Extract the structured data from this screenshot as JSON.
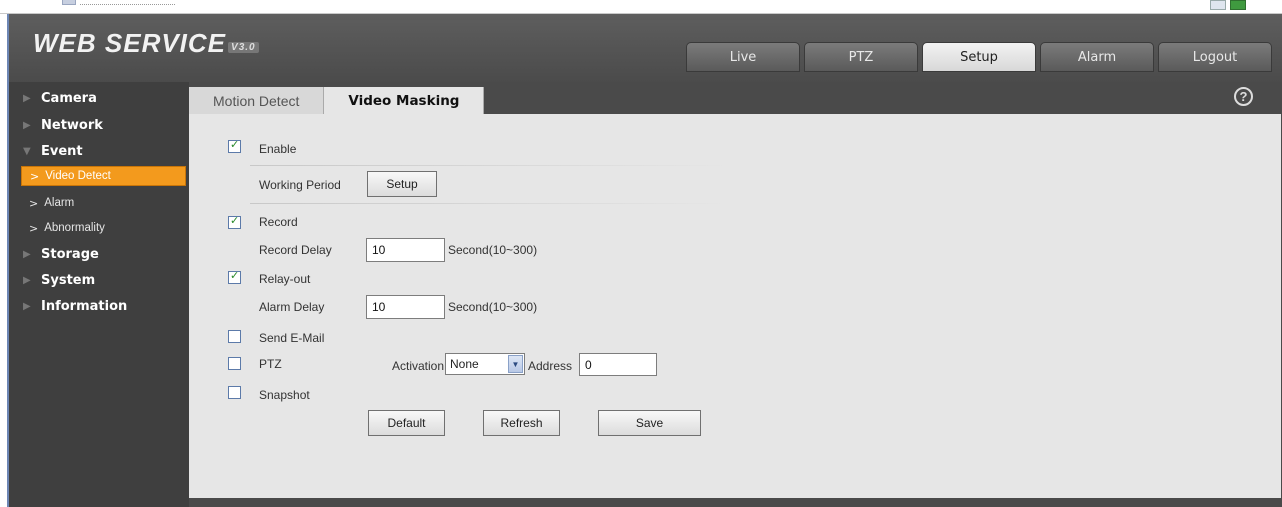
{
  "app": {
    "logo_text": "WEB  SERVICE",
    "logo_version": "V3.0"
  },
  "topnav": [
    {
      "label": "Live"
    },
    {
      "label": "PTZ"
    },
    {
      "label": "Setup"
    },
    {
      "label": "Alarm"
    },
    {
      "label": "Logout"
    }
  ],
  "sidebar": {
    "camera": "Camera",
    "network": "Network",
    "event": "Event",
    "video_detect": "Video Detect",
    "alarm": "Alarm",
    "abnormality": "Abnormality",
    "storage": "Storage",
    "system": "System",
    "information": "Information"
  },
  "tabs": {
    "motion_detect": "Motion Detect",
    "video_masking": "Video Masking"
  },
  "help_glyph": "?",
  "form": {
    "enable_label": "Enable",
    "enable_checked": true,
    "working_period_label": "Working Period",
    "setup_button": "Setup",
    "record_label": "Record",
    "record_checked": true,
    "record_delay_label": "Record Delay",
    "record_delay_value": "10",
    "record_delay_unit": "Second(10~300)",
    "relay_out_label": "Relay-out",
    "relay_out_checked": true,
    "alarm_delay_label": "Alarm Delay",
    "alarm_delay_value": "10",
    "alarm_delay_unit": "Second(10~300)",
    "send_email_label": "Send E-Mail",
    "send_email_checked": false,
    "ptz_label": "PTZ",
    "ptz_checked": false,
    "activation_label": "Activation",
    "activation_value": "None",
    "address_label": "Address",
    "address_value": "0",
    "snapshot_label": "Snapshot",
    "snapshot_checked": false,
    "default_button": "Default",
    "refresh_button": "Refresh",
    "save_button": "Save"
  },
  "colors": {
    "active_menu": "#f39a1d",
    "panel": "#e6e6e6",
    "chrome": "#4a4a4a"
  }
}
